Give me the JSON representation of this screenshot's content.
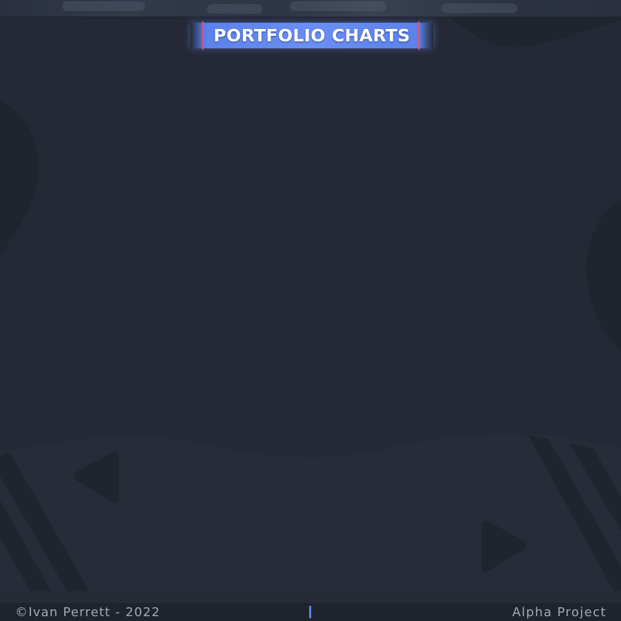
{
  "header": {
    "title": "PORTFOLIO CHARTS"
  },
  "footer": {
    "copyright": "©Ivan Perrett - 2022",
    "project": "Alpha Project"
  },
  "colors": {
    "background": "#252935",
    "accent": "#5b82ec",
    "banner_edge": "#e0557a",
    "footer_text": "#a3a8b4"
  },
  "icons": [
    "play-left-icon",
    "play-right-icon"
  ]
}
